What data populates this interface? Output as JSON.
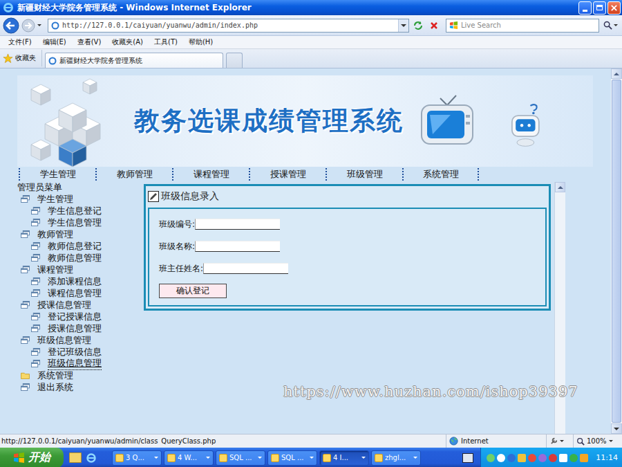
{
  "window": {
    "title": "新疆财经大学院务管理系统 - Windows Internet Explorer"
  },
  "address_bar": {
    "url": "http://127.0.0.1/caiyuan/yuanwu/admin/index.php",
    "search_placeholder": "Live Search"
  },
  "menu_bar": [
    "文件(F)",
    "编辑(E)",
    "查看(V)",
    "收藏夹(A)",
    "工具(T)",
    "帮助(H)"
  ],
  "favorites": {
    "label": "收藏夹"
  },
  "tabs": [
    {
      "label": "新疆财经大学院务管理系统",
      "selected": true
    }
  ],
  "banner": {
    "title": "教务选课成绩管理系统"
  },
  "nav": [
    "学生管理",
    "教师管理",
    "课程管理",
    "授课管理",
    "班级管理",
    "系统管理"
  ],
  "sidebar": {
    "title": "管理员菜单",
    "items": [
      {
        "label": "学生管理",
        "kind": "group",
        "hovered": false
      },
      {
        "label": "学生信息登记",
        "kind": "item",
        "hovered": false
      },
      {
        "label": "学生信息管理",
        "kind": "item",
        "hovered": false
      },
      {
        "label": "教师管理",
        "kind": "group",
        "hovered": false
      },
      {
        "label": "教师信息登记",
        "kind": "item",
        "hovered": false
      },
      {
        "label": "教师信息管理",
        "kind": "item",
        "hovered": false
      },
      {
        "label": "课程管理",
        "kind": "group",
        "hovered": false
      },
      {
        "label": "添加课程信息",
        "kind": "item",
        "hovered": false
      },
      {
        "label": "课程信息管理",
        "kind": "item",
        "hovered": false
      },
      {
        "label": "授课信息管理",
        "kind": "group",
        "hovered": false
      },
      {
        "label": "登记授课信息",
        "kind": "item",
        "hovered": false
      },
      {
        "label": "授课信息管理",
        "kind": "item",
        "hovered": false
      },
      {
        "label": "班级信息管理",
        "kind": "group",
        "hovered": false
      },
      {
        "label": "登记班级信息",
        "kind": "item",
        "hovered": false
      },
      {
        "label": "班级信息管理",
        "kind": "item",
        "hovered": true
      },
      {
        "label": "系统管理",
        "kind": "folder",
        "hovered": false
      },
      {
        "label": "退出系统",
        "kind": "group",
        "hovered": false
      }
    ]
  },
  "form": {
    "title": "班级信息录入",
    "fields": [
      {
        "label": "班级编号:",
        "value": ""
      },
      {
        "label": "班级名称:",
        "value": ""
      },
      {
        "label": "班主任姓名:",
        "value": ""
      }
    ],
    "submit": "确认登记"
  },
  "watermark": "https://www.huzhan.com/ishop39397",
  "status_bar": {
    "url": "http://127.0.0.1/caiyuan/yuanwu/admin/class_QueryClass.php",
    "zone": "Internet",
    "zoom": "100%"
  },
  "taskbar": {
    "start": "开始",
    "tasks": [
      {
        "label": "3 Q...",
        "selected": false
      },
      {
        "label": "4 W...",
        "selected": false
      },
      {
        "label": "SQL ...",
        "selected": false
      },
      {
        "label": "SQL ...",
        "selected": false
      },
      {
        "label": "4 I...",
        "selected": true
      },
      {
        "label": "zhgl...",
        "selected": false
      }
    ],
    "time": "11:14"
  }
}
